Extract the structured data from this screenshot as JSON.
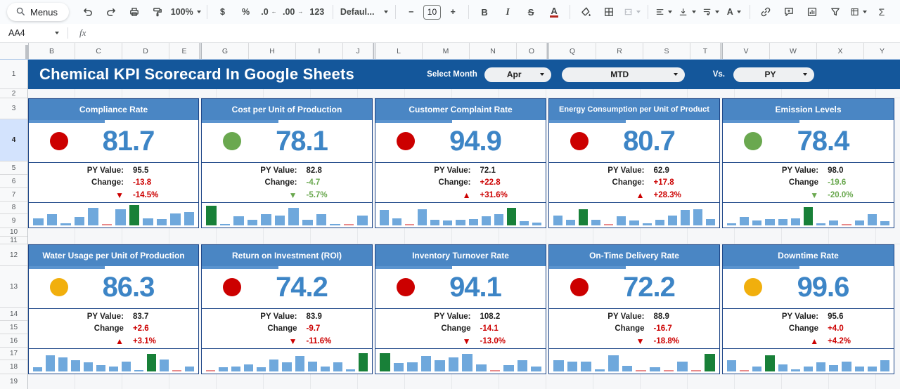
{
  "toolbar": {
    "menus_label": "Menus",
    "zoom_value": "100%",
    "font_value": "Defaul...",
    "font_size_value": "10",
    "glyphs": {
      "currency": "$",
      "percent": "%",
      "decimal_decrease": ".0",
      "decimal_increase": ".00",
      "number_format": "123",
      "decrease_font": "−",
      "increase_font": "+",
      "bold": "B",
      "italic": "I",
      "strikethrough": "S",
      "text_color": "A",
      "text_rotation": "A",
      "functions": "Σ"
    }
  },
  "formula": {
    "name_box_value": "AA4",
    "fx_label": "fx"
  },
  "columns": [
    "B",
    "C",
    "D",
    "E",
    "G",
    "H",
    "I",
    "J",
    "L",
    "M",
    "N",
    "O",
    "Q",
    "R",
    "S",
    "T",
    "V",
    "W",
    "X",
    "Y"
  ],
  "row_numbers": [
    "1",
    "2",
    "3",
    "4",
    "5",
    "6",
    "7",
    "8",
    "9",
    "10",
    "11",
    "12",
    "13",
    "14",
    "15",
    "16",
    "17",
    "18",
    "19"
  ],
  "selected_row": "4",
  "header": {
    "title": "Chemical KPI Scorecard In Google Sheets",
    "select_month_label": "Select Month",
    "month_value": "Apr",
    "period_value": "MTD",
    "vs_label": "Vs.",
    "compare_value": "PY"
  },
  "colors": {
    "title_bar": "#14579b",
    "card_header": "#4a86c4",
    "value_blue": "#3d85c6",
    "red": "#cc0000",
    "green": "#6aa84f",
    "yellow": "#f1af0d",
    "bar_blue": "#6fa8dc",
    "bar_green": "#188038",
    "bar_red": "#e88a8a",
    "selected_row_bg": "#d3e3fd"
  },
  "cards": [
    {
      "title": "Compliance Rate",
      "status": "red",
      "value": "81.7",
      "py_label": "PY Value:",
      "py_value": "95.5",
      "change_label": "Change:",
      "change_value": "-13.8",
      "change_color": "red",
      "arrow": "▼",
      "arrow_color": "red",
      "pct": "-14.5%",
      "bars": [
        {
          "h": 35,
          "c": "b"
        },
        {
          "h": 55,
          "c": "b"
        },
        {
          "h": 12,
          "c": "b"
        },
        {
          "h": 40,
          "c": "b"
        },
        {
          "h": 85,
          "c": "b"
        },
        {
          "h": 5,
          "c": "r"
        },
        {
          "h": 80,
          "c": "b"
        },
        {
          "h": 100,
          "c": "g"
        },
        {
          "h": 35,
          "c": "b"
        },
        {
          "h": 30,
          "c": "b"
        },
        {
          "h": 60,
          "c": "b"
        },
        {
          "h": 65,
          "c": "b"
        }
      ]
    },
    {
      "title": "Cost per Unit of Production",
      "status": "green",
      "value": "78.1",
      "py_label": "PY Value:",
      "py_value": "82.8",
      "change_label": "Change:",
      "change_value": "-4.7",
      "change_color": "green",
      "arrow": "▼",
      "arrow_color": "green",
      "pct": "-5.7%",
      "bars": [
        {
          "h": 95,
          "c": "g"
        },
        {
          "h": 8,
          "c": "b"
        },
        {
          "h": 45,
          "c": "b"
        },
        {
          "h": 28,
          "c": "b"
        },
        {
          "h": 55,
          "c": "b"
        },
        {
          "h": 50,
          "c": "b"
        },
        {
          "h": 85,
          "c": "b"
        },
        {
          "h": 28,
          "c": "b"
        },
        {
          "h": 55,
          "c": "b"
        },
        {
          "h": 8,
          "c": "b"
        },
        {
          "h": 5,
          "c": "r"
        },
        {
          "h": 50,
          "c": "b"
        }
      ]
    },
    {
      "title": "Customer Complaint Rate",
      "status": "red",
      "value": "94.9",
      "py_label": "PY Value:",
      "py_value": "72.1",
      "change_label": "Change:",
      "change_value": "+22.8",
      "change_color": "red",
      "arrow": "▲",
      "arrow_color": "red",
      "pct": "+31.6%",
      "bars": [
        {
          "h": 75,
          "c": "b"
        },
        {
          "h": 35,
          "c": "b"
        },
        {
          "h": 5,
          "c": "r"
        },
        {
          "h": 80,
          "c": "b"
        },
        {
          "h": 28,
          "c": "b"
        },
        {
          "h": 25,
          "c": "b"
        },
        {
          "h": 28,
          "c": "b"
        },
        {
          "h": 30,
          "c": "b"
        },
        {
          "h": 45,
          "c": "b"
        },
        {
          "h": 55,
          "c": "b"
        },
        {
          "h": 85,
          "c": "g"
        },
        {
          "h": 20,
          "c": "b"
        },
        {
          "h": 15,
          "c": "b"
        }
      ]
    },
    {
      "title": "Energy Consumption per Unit of Product",
      "status": "red",
      "value": "80.7",
      "py_label": "PY Value:",
      "py_value": "62.9",
      "change_label": "Change:",
      "change_value": "+17.8",
      "change_color": "red",
      "arrow": "▲",
      "arrow_color": "red",
      "pct": "+28.3%",
      "bars": [
        {
          "h": 50,
          "c": "b"
        },
        {
          "h": 28,
          "c": "b"
        },
        {
          "h": 80,
          "c": "g"
        },
        {
          "h": 28,
          "c": "b"
        },
        {
          "h": 5,
          "c": "r"
        },
        {
          "h": 45,
          "c": "b"
        },
        {
          "h": 25,
          "c": "b"
        },
        {
          "h": 10,
          "c": "b"
        },
        {
          "h": 28,
          "c": "b"
        },
        {
          "h": 50,
          "c": "b"
        },
        {
          "h": 75,
          "c": "b"
        },
        {
          "h": 80,
          "c": "b"
        },
        {
          "h": 30,
          "c": "b"
        }
      ]
    },
    {
      "title": "Emission Levels",
      "status": "green",
      "value": "78.4",
      "py_label": "PY Value:",
      "py_value": "98.0",
      "change_label": "Change",
      "change_value": "-19.6",
      "change_color": "green",
      "arrow": "▼",
      "arrow_color": "green",
      "pct": "-20.0%",
      "bars": [
        {
          "h": 10,
          "c": "b"
        },
        {
          "h": 40,
          "c": "b"
        },
        {
          "h": 25,
          "c": "b"
        },
        {
          "h": 30,
          "c": "b"
        },
        {
          "h": 30,
          "c": "b"
        },
        {
          "h": 35,
          "c": "b"
        },
        {
          "h": 90,
          "c": "g"
        },
        {
          "h": 10,
          "c": "b"
        },
        {
          "h": 25,
          "c": "b"
        },
        {
          "h": 5,
          "c": "r"
        },
        {
          "h": 25,
          "c": "b"
        },
        {
          "h": 55,
          "c": "b"
        },
        {
          "h": 20,
          "c": "b"
        }
      ]
    },
    {
      "title": "Water Usage per Unit of Production",
      "status": "yellow",
      "value": "86.3",
      "py_label": "PY Value:",
      "py_value": "83.7",
      "change_label": "Change",
      "change_value": "+2.6",
      "change_color": "red",
      "arrow": "▲",
      "arrow_color": "red",
      "pct": "+3.1%",
      "bars": [
        {
          "h": 20,
          "c": "b"
        },
        {
          "h": 80,
          "c": "b"
        },
        {
          "h": 70,
          "c": "b"
        },
        {
          "h": 55,
          "c": "b"
        },
        {
          "h": 45,
          "c": "b"
        },
        {
          "h": 30,
          "c": "b"
        },
        {
          "h": 25,
          "c": "b"
        },
        {
          "h": 50,
          "c": "b"
        },
        {
          "h": 8,
          "c": "b"
        },
        {
          "h": 85,
          "c": "g"
        },
        {
          "h": 60,
          "c": "b"
        },
        {
          "h": 4,
          "c": "r"
        },
        {
          "h": 25,
          "c": "b"
        }
      ]
    },
    {
      "title": "Return on Investment (ROI)",
      "status": "red",
      "value": "74.2",
      "py_label": "PY Value:",
      "py_value": "83.9",
      "change_label": "Change",
      "change_value": "-9.7",
      "change_color": "red",
      "arrow": "▼",
      "arrow_color": "red",
      "pct": "-11.6%",
      "bars": [
        {
          "h": 4,
          "c": "r"
        },
        {
          "h": 20,
          "c": "b"
        },
        {
          "h": 25,
          "c": "b"
        },
        {
          "h": 35,
          "c": "b"
        },
        {
          "h": 20,
          "c": "b"
        },
        {
          "h": 60,
          "c": "b"
        },
        {
          "h": 45,
          "c": "b"
        },
        {
          "h": 75,
          "c": "b"
        },
        {
          "h": 50,
          "c": "b"
        },
        {
          "h": 25,
          "c": "b"
        },
        {
          "h": 45,
          "c": "b"
        },
        {
          "h": 10,
          "c": "b"
        },
        {
          "h": 90,
          "c": "g"
        }
      ]
    },
    {
      "title": "Inventory Turnover Rate",
      "status": "red",
      "value": "94.1",
      "py_label": "PY Value:",
      "py_value": "108.2",
      "change_label": "Change",
      "change_value": "-14.1",
      "change_color": "red",
      "arrow": "▼",
      "arrow_color": "red",
      "pct": "-13.0%",
      "bars": [
        {
          "h": 90,
          "c": "g"
        },
        {
          "h": 40,
          "c": "b"
        },
        {
          "h": 45,
          "c": "b"
        },
        {
          "h": 75,
          "c": "b"
        },
        {
          "h": 55,
          "c": "b"
        },
        {
          "h": 70,
          "c": "b"
        },
        {
          "h": 85,
          "c": "b"
        },
        {
          "h": 35,
          "c": "b"
        },
        {
          "h": 4,
          "c": "r"
        },
        {
          "h": 30,
          "c": "b"
        },
        {
          "h": 55,
          "c": "b"
        },
        {
          "h": 25,
          "c": "b"
        }
      ]
    },
    {
      "title": "On-Time Delivery Rate",
      "status": "red",
      "value": "72.2",
      "py_label": "PY Value:",
      "py_value": "88.9",
      "change_label": "Change",
      "change_value": "-16.7",
      "change_color": "red",
      "arrow": "▼",
      "arrow_color": "red",
      "pct": "-18.8%",
      "bars": [
        {
          "h": 55,
          "c": "b"
        },
        {
          "h": 50,
          "c": "b"
        },
        {
          "h": 50,
          "c": "b"
        },
        {
          "h": 12,
          "c": "b"
        },
        {
          "h": 80,
          "c": "b"
        },
        {
          "h": 28,
          "c": "b"
        },
        {
          "h": 4,
          "c": "r"
        },
        {
          "h": 22,
          "c": "b"
        },
        {
          "h": 4,
          "c": "r"
        },
        {
          "h": 50,
          "c": "b"
        },
        {
          "h": 4,
          "c": "r"
        },
        {
          "h": 85,
          "c": "g"
        }
      ]
    },
    {
      "title": "Downtime Rate",
      "status": "yellow",
      "value": "99.6",
      "py_label": "PY Value:",
      "py_value": "95.6",
      "change_label": "Change",
      "change_value": "+4.0",
      "change_color": "red",
      "arrow": "▲",
      "arrow_color": "red",
      "pct": "+4.2%",
      "bars": [
        {
          "h": 55,
          "c": "b"
        },
        {
          "h": 4,
          "c": "r"
        },
        {
          "h": 25,
          "c": "b"
        },
        {
          "h": 80,
          "c": "g"
        },
        {
          "h": 35,
          "c": "b"
        },
        {
          "h": 10,
          "c": "b"
        },
        {
          "h": 25,
          "c": "b"
        },
        {
          "h": 45,
          "c": "b"
        },
        {
          "h": 30,
          "c": "b"
        },
        {
          "h": 50,
          "c": "b"
        },
        {
          "h": 25,
          "c": "b"
        },
        {
          "h": 25,
          "c": "b"
        },
        {
          "h": 55,
          "c": "b"
        }
      ]
    }
  ]
}
